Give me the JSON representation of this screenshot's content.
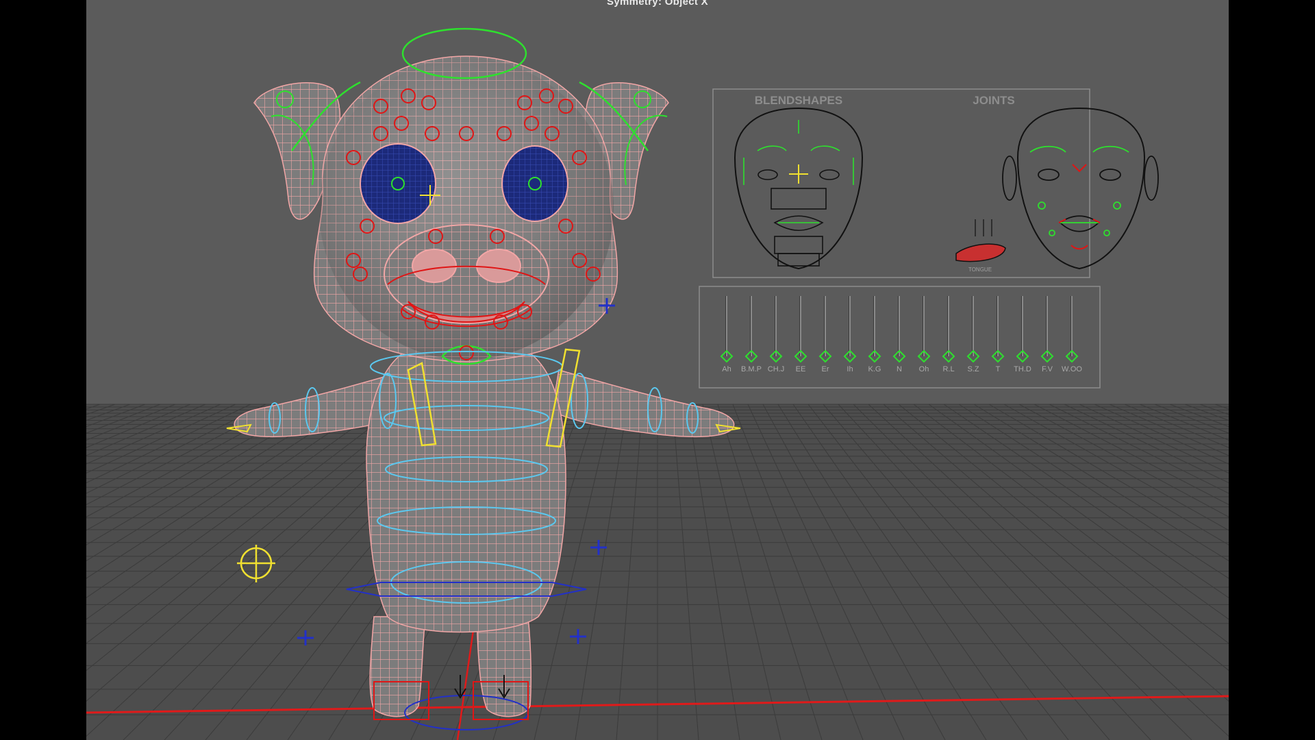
{
  "viewport": {
    "hud_symmetry": "Symmetry: Object X"
  },
  "face_panel": {
    "blendshapes_label": "BLENDSHAPES",
    "joints_label": "JOINTS",
    "tongue_label": "TONGUE"
  },
  "phoneme_sliders": {
    "labels": [
      "Ah",
      "B.M.P",
      "CH.J",
      "EE",
      "Er",
      "Ih",
      "K.G",
      "N",
      "Oh",
      "R.L",
      "S.Z",
      "T",
      "TH.D",
      "F.V",
      "W.OO"
    ]
  },
  "colors": {
    "background": "#5b5b5b",
    "grid": "#3e3e3e",
    "mesh": "#f2a6a6",
    "controls_red": "#e01515",
    "controls_green": "#2ee02e",
    "controls_cyan": "#5bc8ef",
    "controls_yellow": "#f0e030",
    "controls_blue": "#2230c8",
    "axis_red": "#e01a1a"
  },
  "icons": {
    "control_curve": "circle",
    "locator": "cross-icon",
    "pivot": "yellow-cross-icon"
  }
}
